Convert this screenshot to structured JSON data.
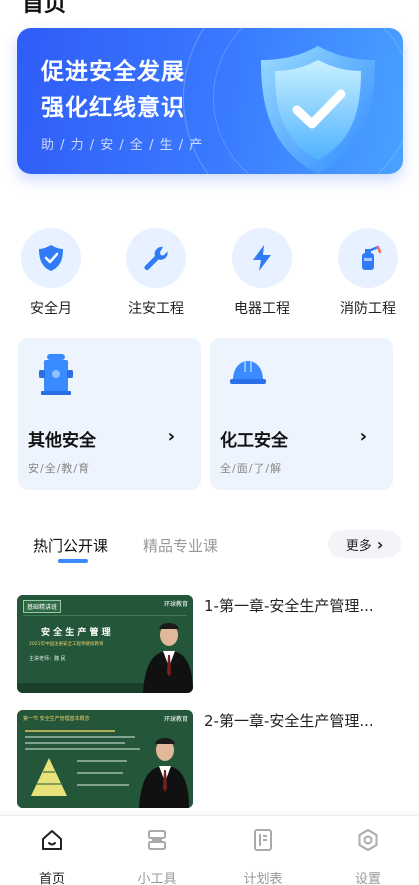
{
  "header": {
    "title": "首页"
  },
  "banner": {
    "line1": "促进安全发展",
    "line2": "强化红线意识",
    "subtitle": "助 / 力 / 安 / 全 / 生 / 产",
    "icon": "shield-check-icon"
  },
  "categories": [
    {
      "label": "安全月",
      "icon": "shield-icon"
    },
    {
      "label": "注安工程",
      "icon": "wrench-icon"
    },
    {
      "label": "电器工程",
      "icon": "lightning-icon"
    },
    {
      "label": "消防工程",
      "icon": "fire-extinguisher-icon"
    }
  ],
  "cards": [
    {
      "title": "其他安全",
      "subtitle": "安/全/教/育",
      "icon": "fire-hydrant-icon"
    },
    {
      "title": "化工安全",
      "subtitle": "全/面/了/解",
      "icon": "hard-hat-icon"
    }
  ],
  "tabs": {
    "active": "热门公开课",
    "inactive": "精品专业课",
    "more": "更多"
  },
  "courses": [
    {
      "title": "1-第一章-安全生产管理...",
      "thumb_tag": "基础精讲班",
      "thumb_heading": "安 全 生 产 管 理",
      "thumb_sub": "2021年中国注册安全工程师继续教育",
      "thumb_teacher": "主讲老师：魏 民",
      "thumb_logo": "环球教育"
    },
    {
      "title": "2-第一章-安全生产管理...",
      "thumb_tag": "第一节 安全生产管理基本概念",
      "thumb_logo": "环球教育"
    }
  ],
  "tabbar": [
    {
      "label": "首页",
      "icon": "home-icon",
      "active": true
    },
    {
      "label": "小工具",
      "icon": "tools-icon",
      "active": false
    },
    {
      "label": "计划表",
      "icon": "document-icon",
      "active": false
    },
    {
      "label": "设置",
      "icon": "settings-icon",
      "active": false
    }
  ],
  "colors": {
    "accent": "#3a8bff",
    "banner": "#2f5cf6",
    "card_bg": "#eef4fd",
    "icon_bg": "#e8f1ff"
  }
}
